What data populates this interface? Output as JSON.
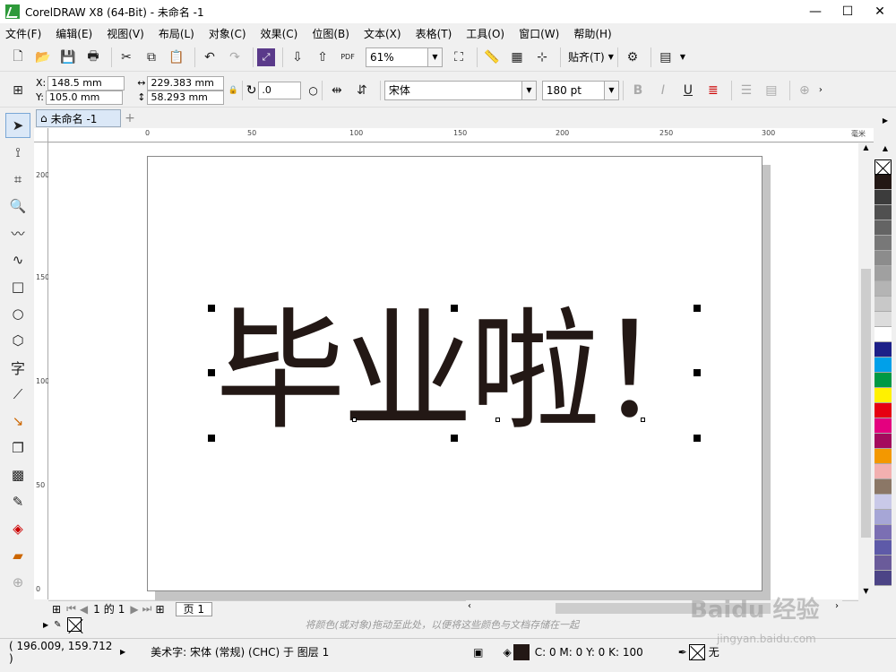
{
  "window": {
    "title": "CorelDRAW X8 (64-Bit) - 未命名 -1",
    "controls": [
      "minimize-icon",
      "maximize-icon",
      "close-icon"
    ]
  },
  "menu": [
    "文件(F)",
    "编辑(E)",
    "视图(V)",
    "布局(L)",
    "对象(C)",
    "效果(C)",
    "位图(B)",
    "文本(X)",
    "表格(T)",
    "工具(O)",
    "窗口(W)",
    "帮助(H)"
  ],
  "toolbar": {
    "zoom": "61%",
    "snap_label": "贴齐(T)",
    "pdf_label": "PDF"
  },
  "propbar": {
    "x_label": "X:",
    "x_value": "148.5 mm",
    "y_label": "Y:",
    "y_value": "105.0 mm",
    "width_value": "229.383 mm",
    "height_value": "58.293 mm",
    "angle_value": ".0",
    "font": "宋体",
    "font_size": "180 pt",
    "bold": "B",
    "italic": "I",
    "underline": "U"
  },
  "doc_tab": "未命名 -1",
  "ruler": {
    "unit": "毫米",
    "h_labels": [
      "0",
      "50",
      "100",
      "150",
      "200",
      "250",
      "300"
    ],
    "v_labels": [
      "200",
      "150",
      "100",
      "50",
      "0"
    ]
  },
  "canvas_text": "毕业啦！",
  "canvas_text_color": "#231815",
  "pagebar": {
    "current": "1",
    "of_label": "的",
    "total": "1",
    "page_tab": "页 1"
  },
  "doc_palette_hint": "将颜色(或对象)拖动至此处，以便将这些颜色与文档存储在一起",
  "status": {
    "coords": "( 196.009, 159.712 )",
    "object_info": "美术字: 宋体 (常规) (CHC) 于 图层 1",
    "fill_info": "C: 0 M: 0 Y: 0 K: 100",
    "outline_label": "无"
  },
  "palette": [
    "#231815",
    "#3c3c3c",
    "#505050",
    "#646464",
    "#787878",
    "#8c8c8c",
    "#a0a0a0",
    "#b4b4b4",
    "#c8c8c8",
    "#dcdcdc",
    "#ffffff",
    "#1d2088",
    "#00a0e9",
    "#009944",
    "#fff100",
    "#e60012",
    "#e4007f",
    "#a40b5d",
    "#f39800",
    "#f2b0b0",
    "#8b7766",
    "#c9c9e8",
    "#a6a6d6",
    "#7b6fb3",
    "#5e5aa8",
    "#6a5b9a",
    "#4c4486"
  ],
  "watermark": "Baidu 经验",
  "watermark_sub": "jingyan.baidu.com"
}
